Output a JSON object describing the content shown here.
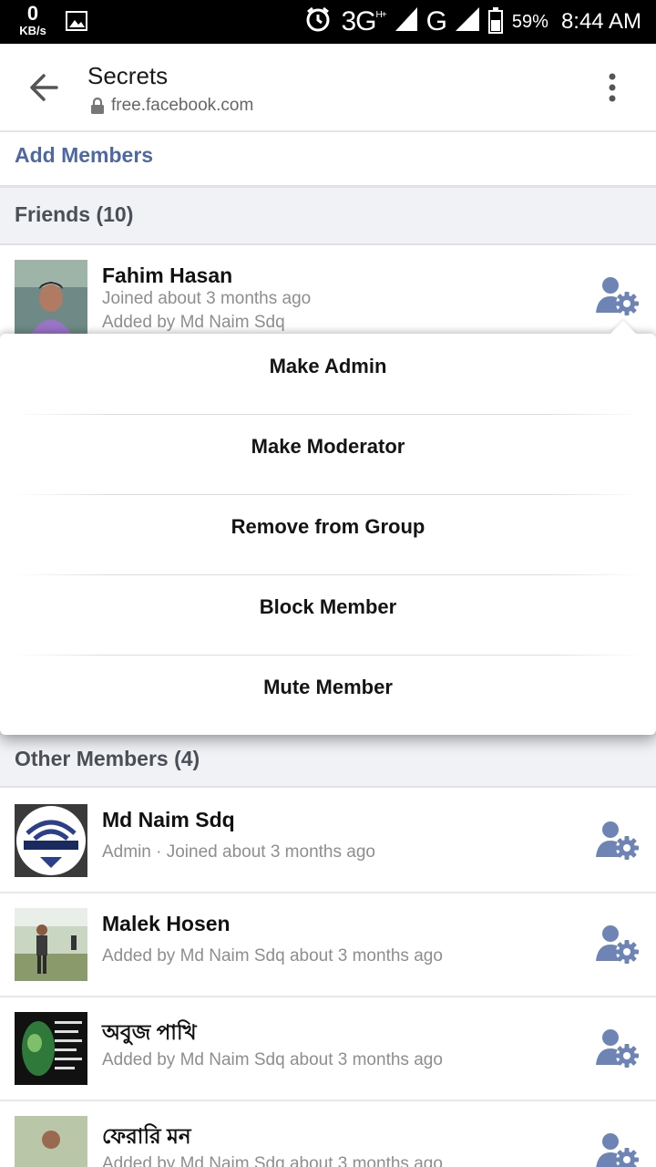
{
  "status_bar": {
    "speed_value": "0",
    "speed_unit": "KB/s",
    "network": "3G",
    "network_sup": "H+",
    "network2": "G",
    "battery": "59%",
    "time": "8:44 AM"
  },
  "app_bar": {
    "title": "Secrets",
    "url": "free.facebook.com"
  },
  "add_members": "Add Members",
  "friends_header": "Friends (10)",
  "friend": {
    "name": "Fahim Hasan",
    "line1": "Joined about 3 months ago",
    "line2": "Added by Md Naim Sdq"
  },
  "popup_menu": {
    "items": [
      "Make Admin",
      "Make Moderator",
      "Remove from Group",
      "Block Member",
      "Mute Member"
    ]
  },
  "other_header": "Other Members (4)",
  "other_members": [
    {
      "name": "Md Naim Sdq",
      "sub": "Admin · Joined about 3 months ago"
    },
    {
      "name": "Malek Hosen",
      "sub": "Added by Md Naim Sdq about 3 months ago"
    },
    {
      "name": "অবুজ পাখি",
      "sub": "Added by Md Naim Sdq about 3 months ago"
    },
    {
      "name": "ফেরারি মন",
      "sub": "Added by Md Naim Sdq about 3 months ago"
    }
  ],
  "icons": {
    "back": "arrow-left-icon",
    "lock": "lock-icon",
    "menu": "more-vertical-icon",
    "member_settings": "member-settings-icon"
  },
  "colors": {
    "link": "#4e69a2",
    "section_bg": "#f0f2f5",
    "gear": "#6d84b4"
  }
}
